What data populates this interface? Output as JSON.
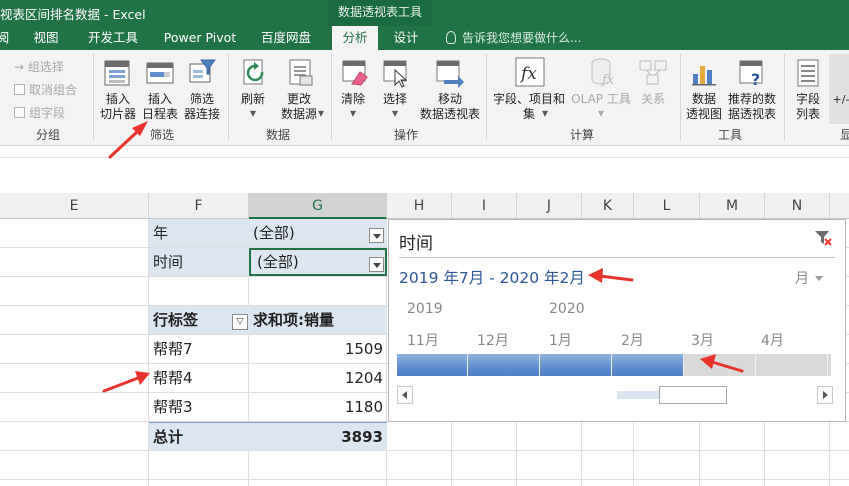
{
  "window": {
    "title": "视表区间排名数据 - Excel",
    "context_tab_group": "数据透视表工具"
  },
  "tabs": [
    {
      "label": "阅"
    },
    {
      "label": "视图"
    },
    {
      "label": "开发工具"
    },
    {
      "label": "Power Pivot"
    },
    {
      "label": "百度网盘"
    },
    {
      "label": "分析",
      "active": true
    },
    {
      "label": "设计"
    }
  ],
  "tell_me": "告诉我您想要做什么...",
  "ribbon": {
    "group_group": {
      "label": "分组",
      "items": [
        "→ 组选择",
        "取消组合",
        "组字段"
      ]
    },
    "filter_group": {
      "label": "筛选",
      "slicer": "插入\n切片器",
      "timeline": "插入\n日程表",
      "connections": "筛选\n器连接"
    },
    "data_group": {
      "label": "数据",
      "refresh": "刷新",
      "change_source": "更改\n数据源"
    },
    "actions_group": {
      "label": "操作",
      "clear": "清除",
      "select": "选择",
      "move": "移动\n数据透视表"
    },
    "calc_group": {
      "label": "计算",
      "fields_items": "字段、项目和\n集",
      "olap": "OLAP 工具",
      "relationships": "关系"
    },
    "tools_group": {
      "label": "工具",
      "pivot_chart": "数据\n透视图",
      "recommended": "推荐的数\n据透视表"
    },
    "show_group": {
      "label": "显",
      "field_list": "字段\n列表",
      "plus_minus": "+/-"
    }
  },
  "columns": [
    "E",
    "F",
    "G",
    "H",
    "I",
    "J",
    "K",
    "L",
    "M",
    "N"
  ],
  "selected_column": "G",
  "pivot": {
    "filters": [
      {
        "field": "年",
        "value": "(全部)"
      },
      {
        "field": "时间",
        "value": "(全部)"
      }
    ],
    "row_label_header": "行标签",
    "value_header": "求和项:销量",
    "rows": [
      {
        "label": "帮帮7",
        "value": "1509"
      },
      {
        "label": "帮帮4",
        "value": "1204"
      },
      {
        "label": "帮帮3",
        "value": "1180"
      }
    ],
    "total_label": "总计",
    "total_value": "3893"
  },
  "timeline": {
    "title": "时间",
    "range_text": "2019 年7月 - 2020 年2月",
    "level": "月",
    "years": [
      "2019",
      "2020"
    ],
    "months": [
      "11月",
      "12月",
      "1月",
      "2月",
      "3月",
      "4月"
    ],
    "selected_months_visible": 4
  },
  "colors": {
    "excel_green": "#217346",
    "pivot_shade": "#dce6f1",
    "timeline_fill": "#5f8ecf",
    "annotation_red": "#e8322b"
  }
}
